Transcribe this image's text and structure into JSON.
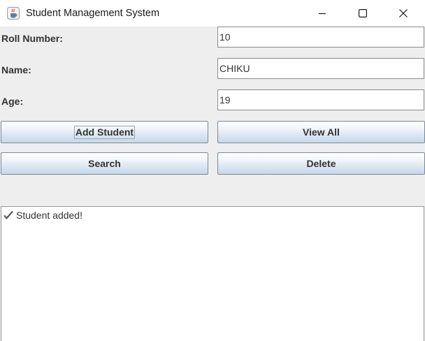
{
  "window": {
    "title": "Student Management System",
    "app_icon": "java-cup-icon",
    "controls": [
      "minimize-icon",
      "maximize-icon",
      "close-icon"
    ]
  },
  "form": {
    "roll_number": {
      "label": "Roll Number:",
      "value": "10"
    },
    "name": {
      "label": "Name:",
      "value": "CHIKU"
    },
    "age": {
      "label": "Age:",
      "value": "19"
    }
  },
  "buttons": {
    "add": "Add Student",
    "view_all": "View All",
    "search": "Search",
    "delete": "Delete"
  },
  "output": {
    "icon": "check-mark-icon",
    "message": "Student added!"
  },
  "colors": {
    "window_background": "#eeeeee",
    "titlebar_background": "#ffffff",
    "button_gradient_top": "#ffffff",
    "button_gradient_bottom": "#c6d8ea",
    "button_border": "#7a8a99",
    "text": "#333333"
  }
}
